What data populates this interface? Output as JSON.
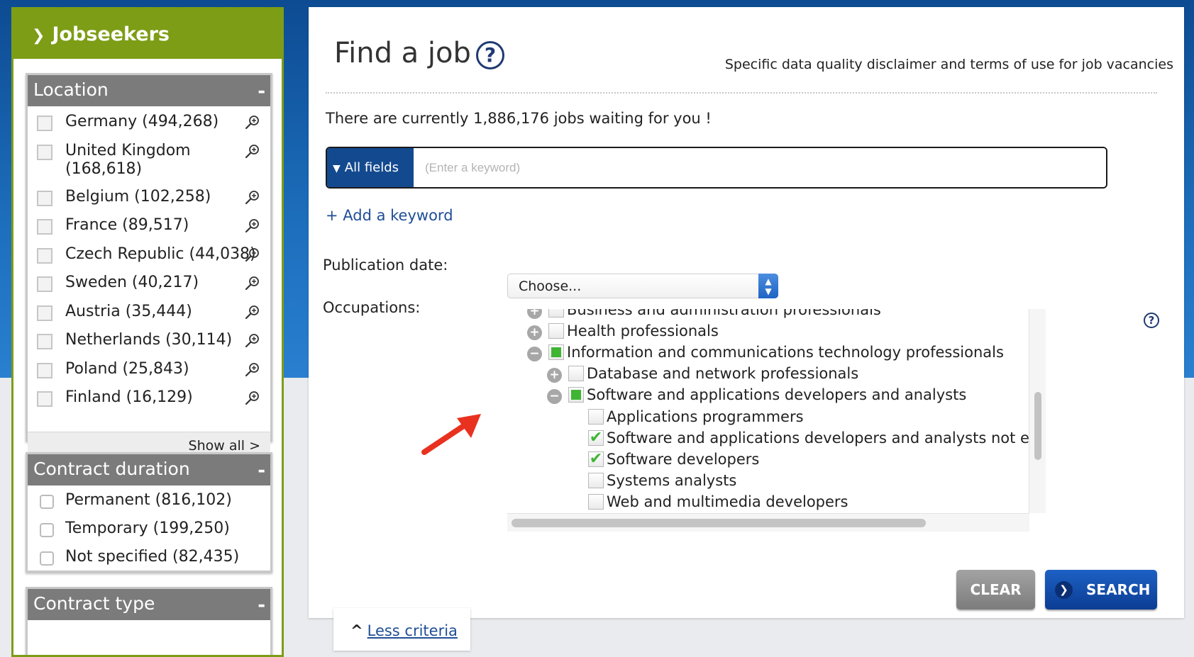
{
  "sidebar": {
    "header": "Jobseekers",
    "location": {
      "title": "Location",
      "collapse": "-",
      "items": [
        {
          "label": "Germany (494,268)"
        },
        {
          "label": "United Kingdom (168,618)"
        },
        {
          "label": "Belgium (102,258)"
        },
        {
          "label": "France (89,517)"
        },
        {
          "label": "Czech Republic (44,038)"
        },
        {
          "label": "Sweden (40,217)"
        },
        {
          "label": "Austria (35,444)"
        },
        {
          "label": "Netherlands (30,114)"
        },
        {
          "label": "Poland (25,843)"
        },
        {
          "label": "Finland (16,129)"
        }
      ],
      "show_all": "Show all >"
    },
    "contract_duration": {
      "title": "Contract duration",
      "collapse": "-",
      "items": [
        {
          "label": "Permanent (816,102)"
        },
        {
          "label": "Temporary (199,250)"
        },
        {
          "label": "Not specified (82,435)"
        }
      ]
    },
    "contract_type": {
      "title": "Contract type",
      "collapse": "-"
    }
  },
  "main": {
    "title": "Find a job",
    "help": "?",
    "disclaimer": "Specific data quality disclaimer and terms of use for job vacancies",
    "jobs_count_text": "There are currently 1,886,176 jobs waiting for you !",
    "keyword": {
      "field_select": "All fields",
      "placeholder": "(Enter a keyword)",
      "value": ""
    },
    "add_keyword": "+ Add a keyword",
    "publication_date": {
      "label": "Publication date:",
      "value": "Choose..."
    },
    "occupations": {
      "label": "Occupations:",
      "tree": [
        {
          "label": "Business and administration professionals",
          "level": 0,
          "expander": "+",
          "state": "unchecked"
        },
        {
          "label": "Health professionals",
          "level": 0,
          "expander": "+",
          "state": "unchecked"
        },
        {
          "label": "Information and communications technology professionals",
          "level": 0,
          "expander": "-",
          "state": "partial"
        },
        {
          "label": "Database and network professionals",
          "level": 1,
          "expander": "+",
          "state": "unchecked"
        },
        {
          "label": "Software and applications developers and analysts",
          "level": 1,
          "expander": "-",
          "state": "partial"
        },
        {
          "label": "Applications programmers",
          "level": 2,
          "expander": "",
          "state": "unchecked"
        },
        {
          "label": "Software and applications developers and analysts not elsewhere classified",
          "level": 2,
          "expander": "",
          "state": "checked"
        },
        {
          "label": "Software developers",
          "level": 2,
          "expander": "",
          "state": "checked"
        },
        {
          "label": "Systems analysts",
          "level": 2,
          "expander": "",
          "state": "unchecked"
        },
        {
          "label": "Web and multimedia developers",
          "level": 2,
          "expander": "",
          "state": "unchecked"
        }
      ]
    },
    "buttons": {
      "clear": "CLEAR",
      "search": "SEARCH"
    },
    "less_criteria": "Less criteria"
  },
  "colors": {
    "sidebar_green": "#7d9d16",
    "panel_grey": "#7b7b7b",
    "accent_blue": "#134a8f",
    "link_blue": "#1f4e96",
    "check_green": "#3fb534",
    "arrow_red": "#e8321f"
  },
  "icons": {
    "chevron": "chevron-right-icon",
    "loupe": "zoom-in-icon",
    "help": "question-circle-icon"
  }
}
